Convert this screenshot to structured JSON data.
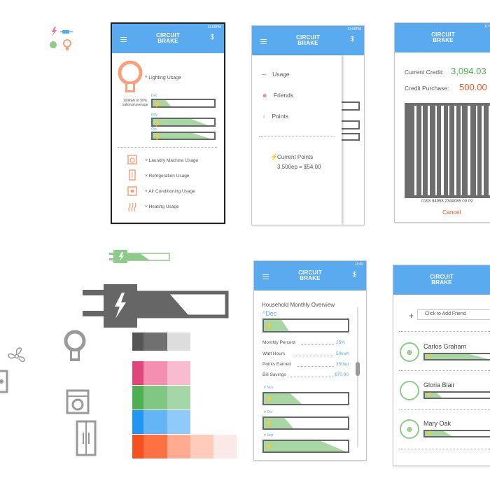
{
  "app": {
    "title_line1": "CIRCUIT",
    "title_line2": "BRAKE",
    "dollar": "$",
    "time": "11:00PM",
    "time_short": "11:00"
  },
  "screen1": {
    "lighting_label": "Lighting Usage",
    "national_note": "100kwh or 50% national average",
    "months": [
      "Dec",
      "Nov",
      "Oct"
    ],
    "month_fills": [
      0.3,
      0.9,
      0.93
    ],
    "items": [
      "Laundry Machine Usage",
      "Refrigeration Usage",
      "Air Conditioning Usage",
      "Heating Usage"
    ]
  },
  "screen2": {
    "menu": [
      "Usage",
      "Friends",
      "Points"
    ],
    "current_points_label": "Current Points",
    "current_points_value": "3,500ep = $54.00"
  },
  "screen3": {
    "current_credit_label": "Current Credit:",
    "current_credit_value": "3,094.03",
    "credit_purchase_label": "Credit Purchase:",
    "credit_purchase_value": "500.00",
    "barcode_number": "0193 94958 2349085 09 09",
    "cancel": "Cancel"
  },
  "screen4": {
    "heading": "Household Monthly Overview",
    "month": "Dec",
    "dec_fill": 0.3,
    "stats": [
      {
        "label": "Monthly Percent",
        "value": "25%"
      },
      {
        "label": "Watt Hours",
        "value": "50kwh"
      },
      {
        "label": "Points Earned",
        "value": "350ep"
      },
      {
        "label": "Bill Savings",
        "value": "$70.00"
      }
    ],
    "months": [
      "Nov",
      "Oct",
      "Sep"
    ],
    "month_fills": [
      0.45,
      0.35,
      0.97
    ]
  },
  "screen5": {
    "add_friend_placeholder": "Click to Add Friend",
    "friends": [
      {
        "name": "Carlos Graham",
        "fill": 0.95
      },
      {
        "name": "Gloria Blair",
        "fill": 0.25
      },
      {
        "name": "Mary Oak",
        "fill": 0.4
      }
    ]
  },
  "style_guide": {
    "grays": [
      "#555555",
      "#707070",
      "#dddddd"
    ],
    "pinks": [
      "#e0457b",
      "#f48fb1",
      "#f8bbd0"
    ],
    "greens": [
      "#4caf50",
      "#81c784",
      "#a5d6a7"
    ],
    "blues": [
      "#2196f3",
      "#64b5f6",
      "#90caf9"
    ],
    "oranges": [
      "#f4511e",
      "#ff7043",
      "#ffab91",
      "#ffccbc",
      "#fbe9e7"
    ],
    "small_plug_fill": 0.3,
    "big_plug_fill": 0.35
  },
  "colors": {
    "accent": "#5aaaf0",
    "green": "#a9d7a4",
    "orange": "#f4511e",
    "border": "#666666"
  }
}
